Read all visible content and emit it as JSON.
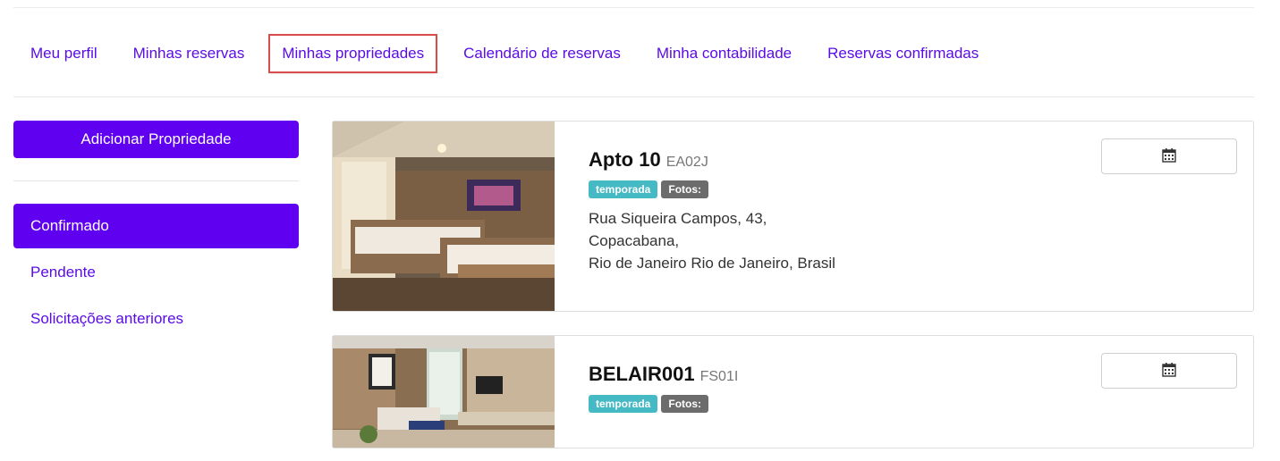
{
  "nav": {
    "items": [
      {
        "label": "Meu perfil"
      },
      {
        "label": "Minhas reservas"
      },
      {
        "label": "Minhas propriedades"
      },
      {
        "label": "Calendário de reservas"
      },
      {
        "label": "Minha contabilidade"
      },
      {
        "label": "Reservas confirmadas"
      }
    ],
    "selected": "Minhas propriedades"
  },
  "sidebar": {
    "add_button": "Adicionar Propriedade",
    "items": [
      {
        "label": "Confirmado"
      },
      {
        "label": "Pendente"
      },
      {
        "label": "Solicitações anteriores"
      }
    ],
    "active": "Confirmado"
  },
  "properties": [
    {
      "name": "Apto 10",
      "code": "EA02J",
      "badges": {
        "type": "temporada",
        "photos": "Fotos:"
      },
      "address": {
        "line1": "Rua Siqueira Campos, 43,",
        "line2": "Copacabana,",
        "line3": "Rio de Janeiro Rio de Janeiro, Brasil"
      },
      "calendar_icon": "calendar-icon"
    },
    {
      "name": "BELAIR001",
      "code": "FS01I",
      "badges": {
        "type": "temporada",
        "photos": "Fotos:"
      },
      "calendar_icon": "calendar-icon"
    }
  ],
  "colors": {
    "accent": "#5f00f0",
    "link": "#5a0ce6",
    "badge_teal": "#45b9c4",
    "badge_gray": "#6c6c6c",
    "highlight": "#d94c4c"
  }
}
